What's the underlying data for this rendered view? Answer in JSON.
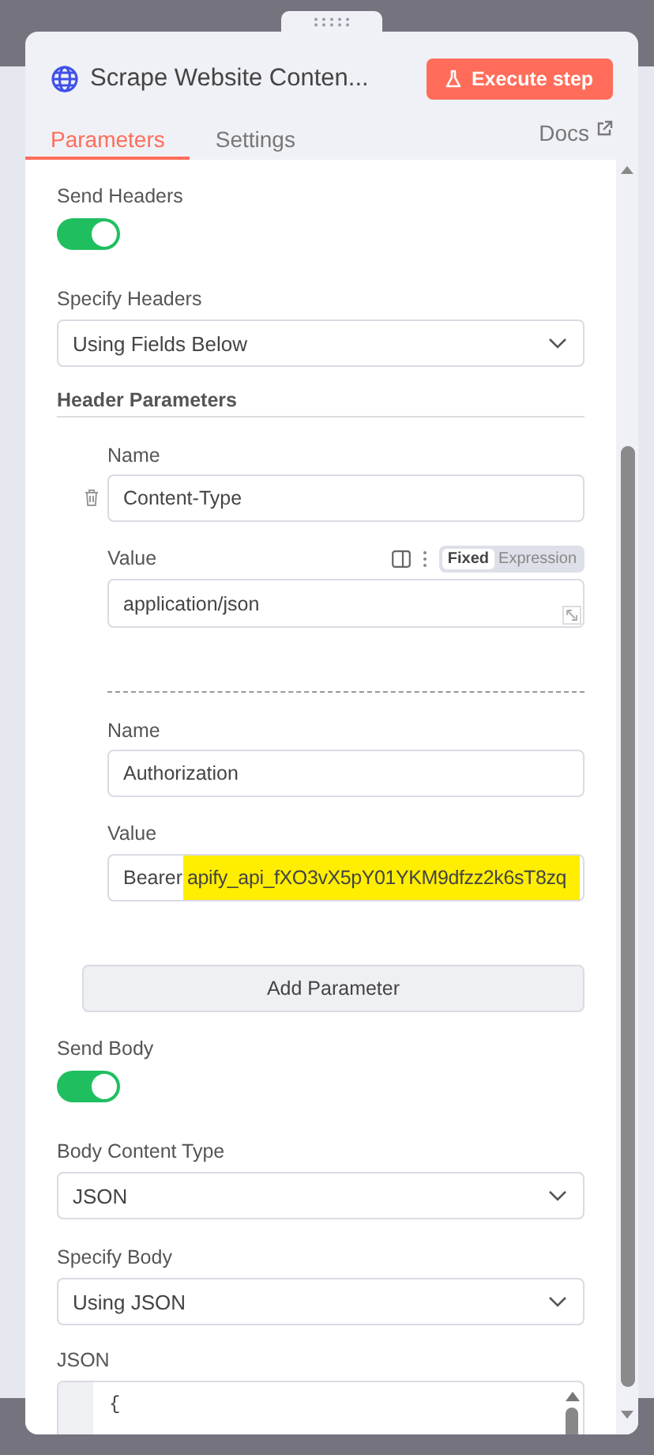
{
  "node": {
    "title": "Scrape Website Conten...",
    "execute_button": "Execute step"
  },
  "tabs": [
    {
      "label": "Parameters",
      "selected": true
    },
    {
      "label": "Settings",
      "selected": false
    }
  ],
  "docs_link": "Docs",
  "parameters": [
    {
      "kind": "toggle",
      "label": "Send Headers",
      "on": true
    },
    {
      "kind": "select",
      "label": "Specify Headers",
      "value": "Using Fields Below"
    },
    {
      "kind": "collection",
      "label": "Header Parameters",
      "add_button": "Add Parameter",
      "items": [
        {
          "name_label": "Name",
          "name": "Content-Type",
          "value_label": "Value",
          "value_parts": [
            {
              "text": "application/json",
              "highlighted": false
            }
          ],
          "mode_options": [
            {
              "label": "Fixed",
              "selected": true
            },
            {
              "label": "Expression",
              "selected": false
            }
          ]
        },
        {
          "name_label": "Name",
          "name": "Authorization",
          "value_label": "Value",
          "value_parts": [
            {
              "text": "Bearer",
              "highlighted": false
            },
            {
              "text": "apify_api_fXO3vX5pY01YKM9dfzz2k6sT8zq",
              "highlighted": true
            }
          ]
        }
      ]
    },
    {
      "kind": "toggle",
      "label": "Send Body",
      "on": true
    },
    {
      "kind": "select",
      "label": "Body Content Type",
      "value": "JSON"
    },
    {
      "kind": "select",
      "label": "Specify Body",
      "value": "Using JSON"
    },
    {
      "kind": "code",
      "label": "JSON",
      "lines": [
        "{"
      ]
    }
  ]
}
